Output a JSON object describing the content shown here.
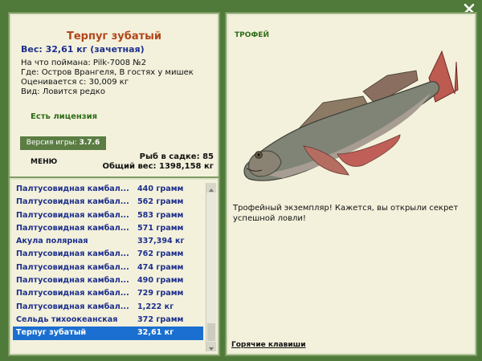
{
  "header": {
    "fish_name": "Терпуг зубатый",
    "weight_line": "Вес: 32,61 кг (зачетная)"
  },
  "details": {
    "bait": "На что поймана: Pilk-7008 №2",
    "location": "Где: Остров Врангеля, В гостях у мишек",
    "price": "Оценивается с: 30,009 кг",
    "type": "Вид: Ловится редко"
  },
  "license": "Есть лицензия",
  "version_label": "Версия игры:",
  "version_value": "3.7.6",
  "menu_label": "МЕНЮ",
  "cage": {
    "count": "Рыб в садке: 85",
    "total": "Общий вес: 1398,158 кг"
  },
  "list": [
    {
      "name": "Палтусовидная камбал...",
      "weight": "440 грамм"
    },
    {
      "name": "Палтусовидная камбал...",
      "weight": "562 грамм"
    },
    {
      "name": "Палтусовидная камбал...",
      "weight": "583 грамм"
    },
    {
      "name": "Палтусовидная камбал...",
      "weight": "571 грамм"
    },
    {
      "name": "Акула полярная",
      "weight": "337,394 кг"
    },
    {
      "name": "Палтусовидная камбал...",
      "weight": "762 грамм"
    },
    {
      "name": "Палтусовидная камбал...",
      "weight": "474 грамм"
    },
    {
      "name": "Палтусовидная камбал...",
      "weight": "490 грамм"
    },
    {
      "name": "Палтусовидная камбал...",
      "weight": "729 грамм"
    },
    {
      "name": "Палтусовидная камбал...",
      "weight": "1,222 кг"
    },
    {
      "name": "Сельдь тихоокеанская",
      "weight": "372 грамм"
    },
    {
      "name": "Терпуг зубатый",
      "weight": "32,61 кг"
    }
  ],
  "selected_index": 11,
  "trophy": {
    "title": "ТРОФЕЙ",
    "text": "Трофейный экземпляр! Кажется, вы открыли секрет успешной ловли!"
  },
  "hotkeys": "Горячие клавиши",
  "icons": {
    "close": "close-icon"
  },
  "colors": {
    "background": "#4f7a3a",
    "panel": "#f3f1dc",
    "title": "#b2441a",
    "list_text": "#1d2f8c",
    "selected": "#1b6fd0",
    "license": "#2f6d18"
  }
}
